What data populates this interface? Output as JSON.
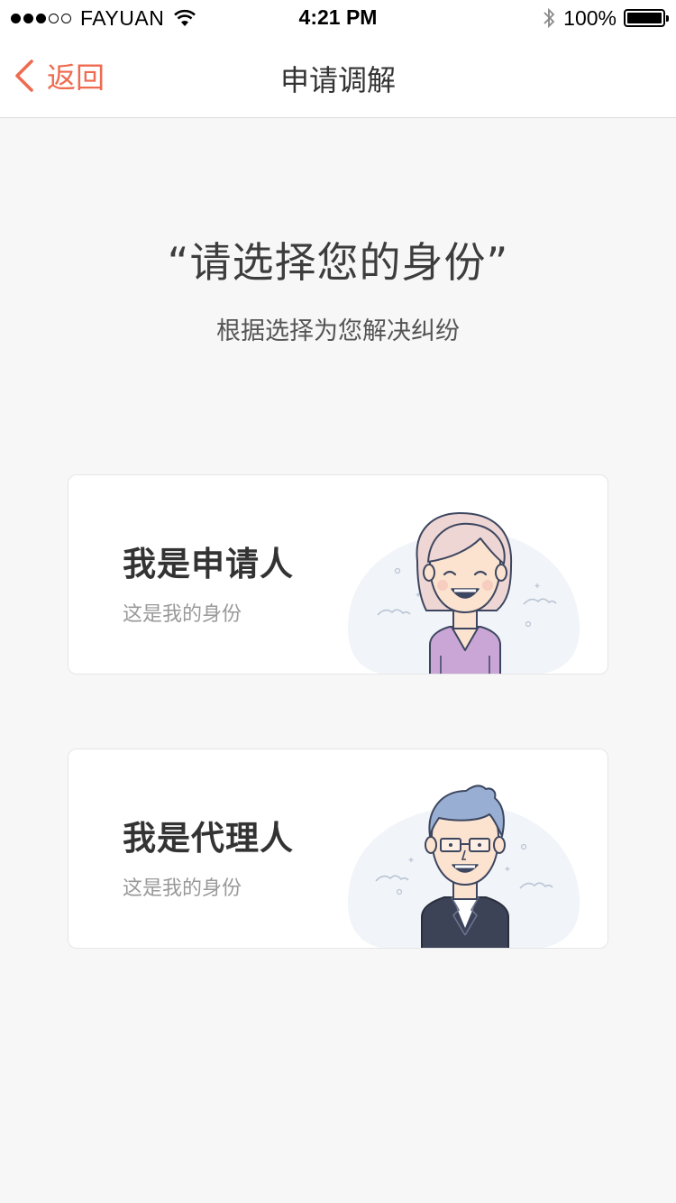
{
  "status_bar": {
    "carrier": "FAYUAN",
    "time": "4:21 PM",
    "battery": "100%"
  },
  "nav": {
    "back_label": "返回",
    "title": "申请调解"
  },
  "main": {
    "heading": "“请选择您的身份”",
    "subheading": "根据选择为您解决纠纷"
  },
  "options": [
    {
      "title": "我是申请人",
      "subtitle": "这是我的身份",
      "icon": "applicant-woman-avatar-icon"
    },
    {
      "title": "我是代理人",
      "subtitle": "这是我的身份",
      "icon": "agent-man-avatar-icon"
    }
  ],
  "colors": {
    "accent": "#ef6b4f",
    "background": "#f8f7f8",
    "card": "#ffffff"
  }
}
